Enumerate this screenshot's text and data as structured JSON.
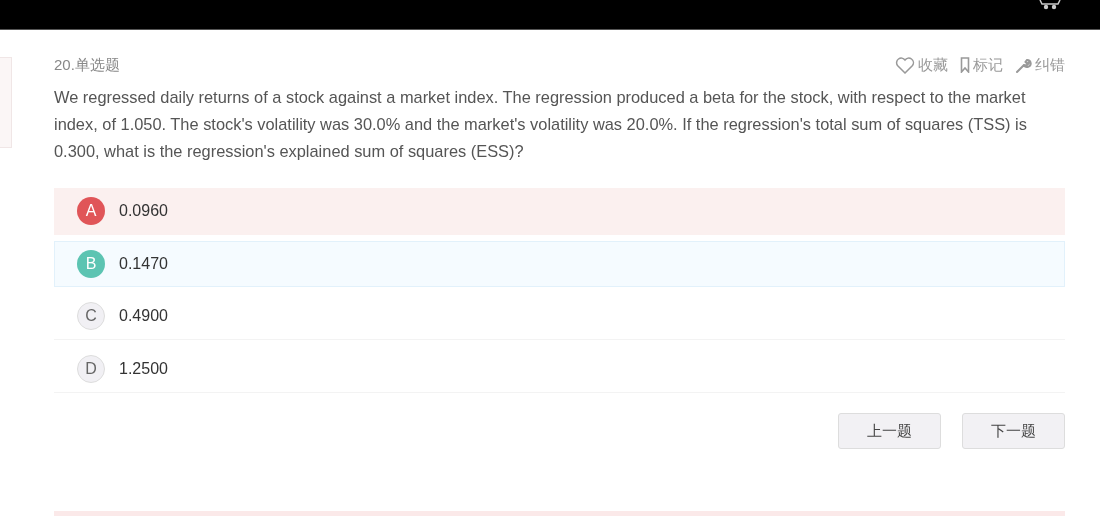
{
  "question": {
    "number_type": "20.单选题",
    "actions": [
      {
        "kind": "favorite",
        "label": "收藏"
      },
      {
        "kind": "mark",
        "label": "标记"
      },
      {
        "kind": "report",
        "label": "纠错"
      }
    ],
    "text": "We regressed daily returns of a stock against a market index. The regression produced a beta for the stock, with respect to the market index, of 1.050. The stock's volatility was 30.0% and the market's volatility was 20.0%. If the regression's total sum of squares (TSS) is 0.300, what is the regression's explained sum of squares (ESS)?"
  },
  "options": [
    {
      "letter": "A",
      "text": "0.0960",
      "kind": "wrong"
    },
    {
      "letter": "B",
      "text": "0.1470",
      "kind": "correct"
    },
    {
      "letter": "C",
      "text": "0.4900",
      "kind": "plain"
    },
    {
      "letter": "D",
      "text": "1.2500",
      "kind": "plain"
    }
  ],
  "buttons": [
    {
      "label": "上一题"
    },
    {
      "label": "下一题"
    }
  ]
}
